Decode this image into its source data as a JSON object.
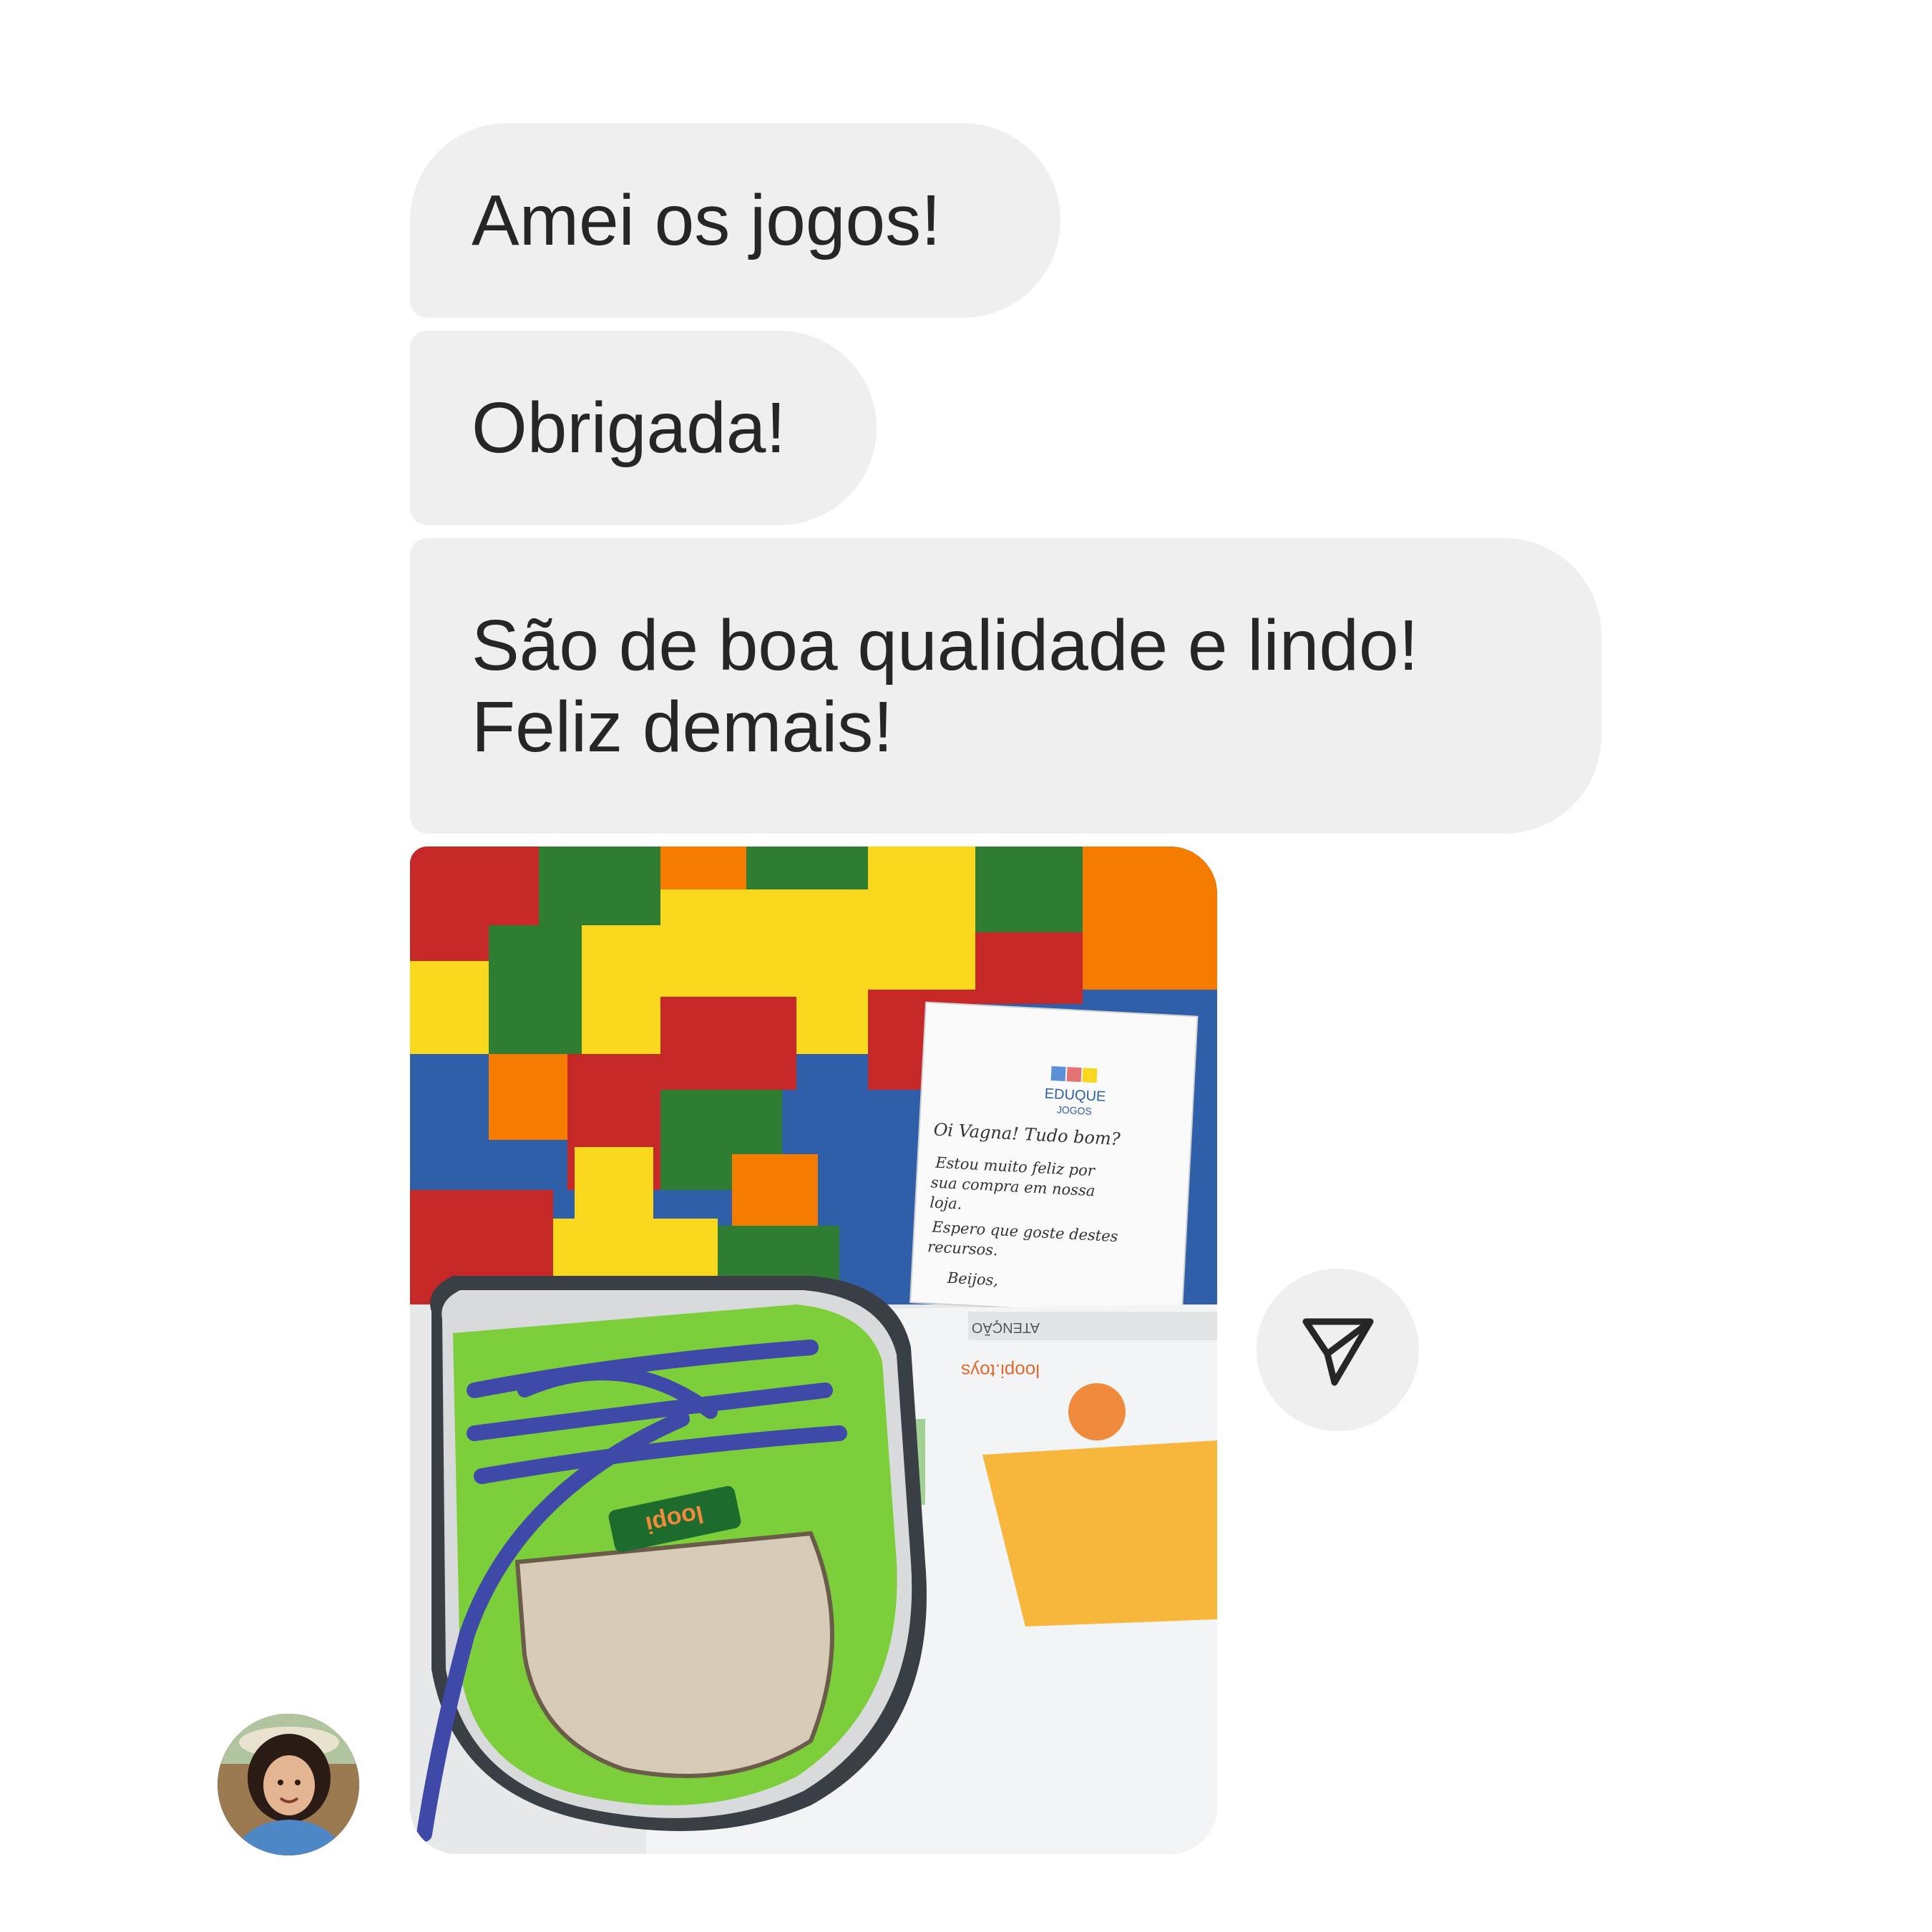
{
  "messages": [
    {
      "text": "Amei os jogos!"
    },
    {
      "text": "Obrigada!"
    },
    {
      "text": "São de boa qualidade e lindo!\nFeliz demais!"
    }
  ],
  "colors": {
    "bubble_background": "#efefef",
    "bubble_text": "#262626",
    "page_background": "#ffffff"
  },
  "photo_attachment": {
    "note_logo": "EDUQUE",
    "note_logo_sub": "JOGOS",
    "note_lines": [
      "Oi Vagna! Tudo bom?",
      "Estou muito feliz por",
      "sua compra em nossa",
      "loja.",
      "Espero que goste destes",
      "recursos.",
      "Beijos,"
    ],
    "shoe_brand": "loopi",
    "box_brand": "loopi.toys",
    "box_warning": "ATENÇÃO"
  },
  "icons": {
    "share": "send-paper-plane-icon",
    "avatar": "user-avatar"
  }
}
